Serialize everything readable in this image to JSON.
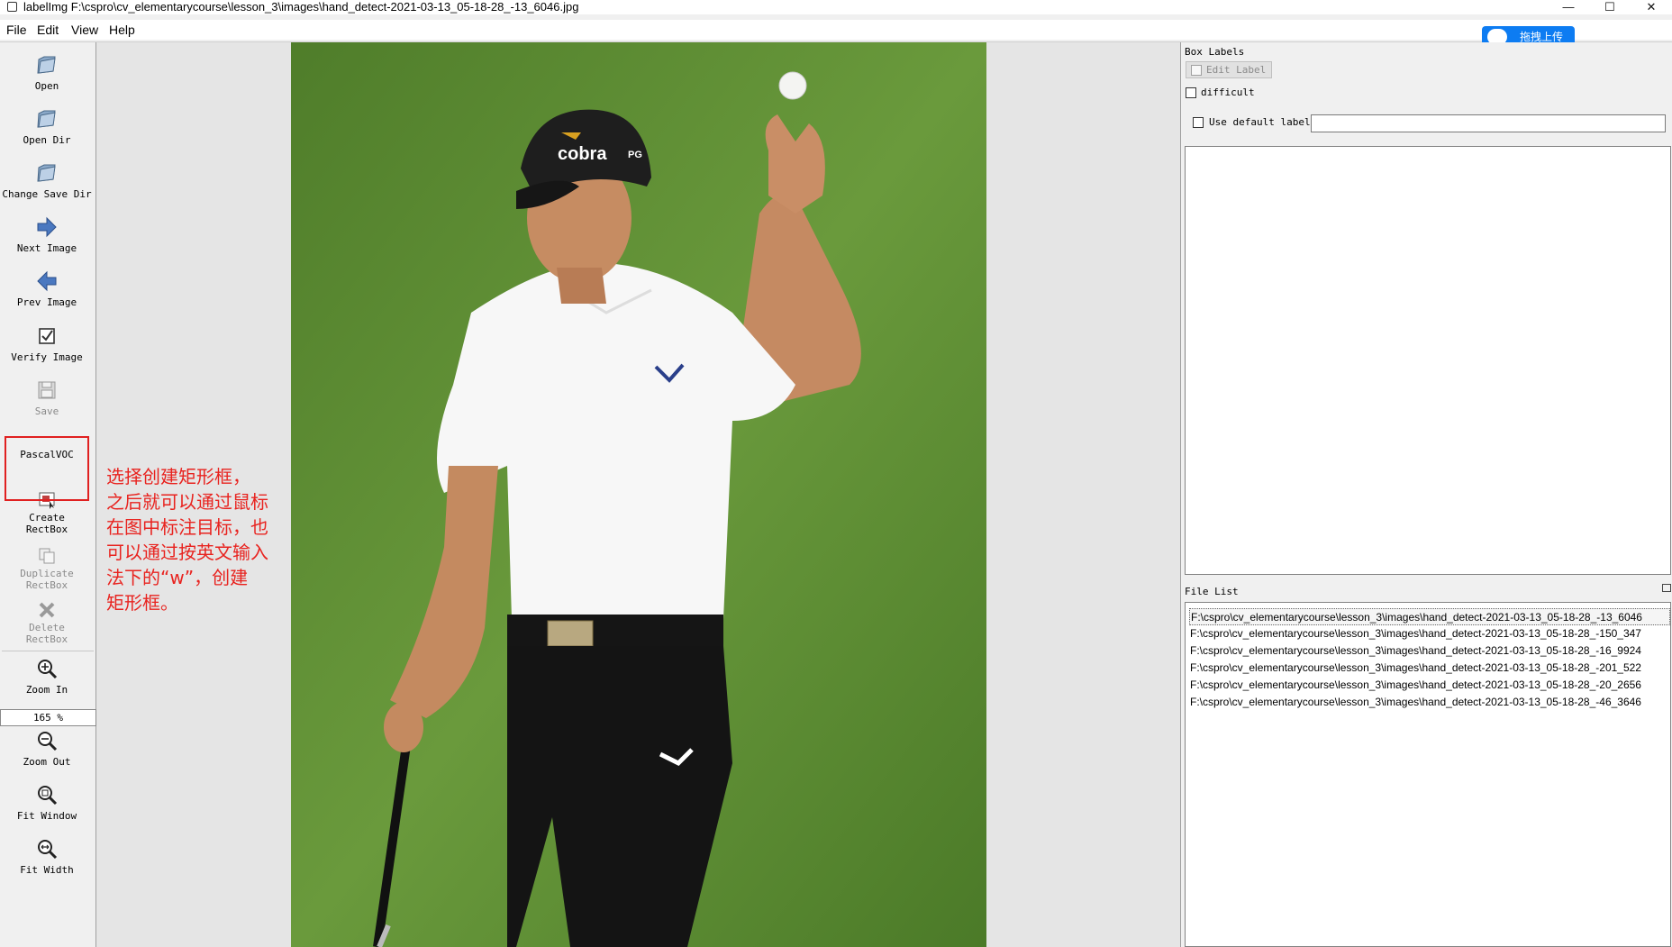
{
  "window": {
    "title": "labelImg F:\\cspro\\cv_elementarycourse\\lesson_3\\images\\hand_detect-2021-03-13_05-18-28_-13_6046.jpg",
    "minimize": "—",
    "maximize": "☐",
    "close": "✕"
  },
  "menu": [
    "File",
    "Edit",
    "View",
    "Help"
  ],
  "toolbar": {
    "open": "Open",
    "open_dir": "Open Dir",
    "change_save_dir": "Change Save Dir",
    "next_image": "Next Image",
    "prev_image": "Prev Image",
    "verify_image": "Verify Image",
    "save": "Save",
    "format": "PascalVOC",
    "create_rectbox_1": "Create",
    "create_rectbox_2": "RectBox",
    "duplicate_rectbox_1": "Duplicate",
    "duplicate_rectbox_2": "RectBox",
    "delete_rectbox_1": "Delete",
    "delete_rectbox_2": "RectBox",
    "zoom_in": "Zoom In",
    "zoom_value": "165 %",
    "zoom_out": "Zoom Out",
    "fit_window": "Fit Window",
    "fit_width": "Fit Width"
  },
  "annotation": {
    "lines": [
      "选择创建矩形框，",
      "之后就可以通过鼠标",
      "在图中标注目标，也",
      "可以通过按英文输入",
      "法下的“w”，创建",
      "矩形框。"
    ]
  },
  "box_labels": {
    "title": "Box Labels",
    "edit_label": "Edit Label",
    "difficult": "difficult",
    "use_default_label": "Use default label",
    "default_label_value": ""
  },
  "file_list": {
    "title": "File List",
    "items": [
      "F:\\cspro\\cv_elementarycourse\\lesson_3\\images\\hand_detect-2021-03-13_05-18-28_-13_6046",
      "F:\\cspro\\cv_elementarycourse\\lesson_3\\images\\hand_detect-2021-03-13_05-18-28_-150_347",
      "F:\\cspro\\cv_elementarycourse\\lesson_3\\images\\hand_detect-2021-03-13_05-18-28_-16_9924",
      "F:\\cspro\\cv_elementarycourse\\lesson_3\\images\\hand_detect-2021-03-13_05-18-28_-201_522",
      "F:\\cspro\\cv_elementarycourse\\lesson_3\\images\\hand_detect-2021-03-13_05-18-28_-20_2656",
      "F:\\cspro\\cv_elementarycourse\\lesson_3\\images\\hand_detect-2021-03-13_05-18-28_-46_3646"
    ]
  },
  "overlay": {
    "upload_label": "拖拽上传"
  },
  "photo": {
    "cap_logo": "cobra",
    "cap_side": "PG"
  }
}
